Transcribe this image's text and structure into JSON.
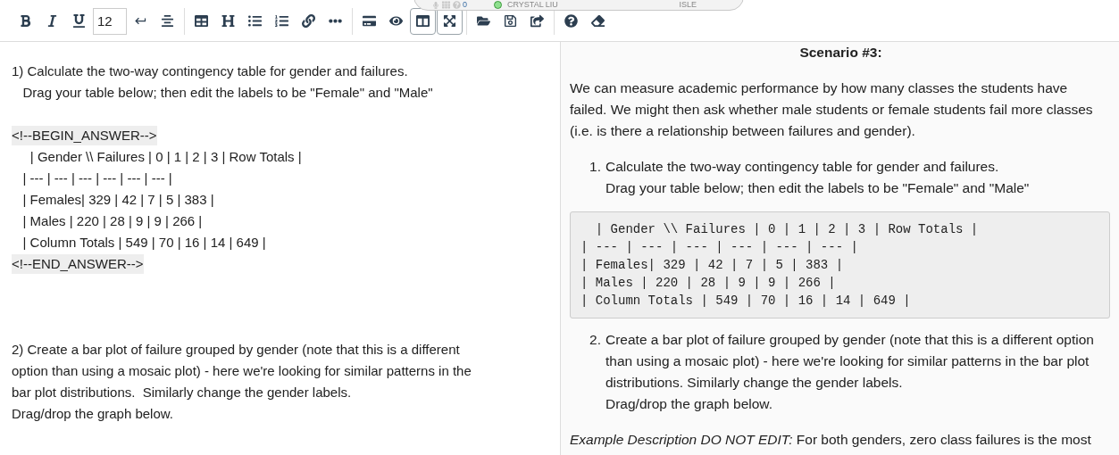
{
  "status_panel": {
    "count": "0",
    "online": true,
    "user": "CRYSTAL LIU",
    "app": "ISLE"
  },
  "toolbar": {
    "groups": [
      [
        {
          "kind": "bold",
          "selected": false
        },
        {
          "kind": "italic",
          "selected": false
        },
        {
          "kind": "underline",
          "selected": false
        },
        {
          "kind": "font_size",
          "value": "12"
        },
        {
          "kind": "line_break",
          "selected": false
        },
        {
          "kind": "horizontal_rule",
          "selected": false
        }
      ],
      [
        {
          "kind": "table",
          "selected": false
        },
        {
          "kind": "heading",
          "selected": false
        },
        {
          "kind": "bullet_list",
          "selected": false
        },
        {
          "kind": "numbered_list",
          "selected": false
        },
        {
          "kind": "link",
          "selected": false
        },
        {
          "kind": "more",
          "selected": false
        }
      ],
      [
        {
          "kind": "card",
          "selected": false
        },
        {
          "kind": "preview",
          "selected": false
        },
        {
          "kind": "split_view",
          "selected": true
        },
        {
          "kind": "fullscreen",
          "selected": true
        }
      ],
      [
        {
          "kind": "open",
          "selected": false
        },
        {
          "kind": "save",
          "selected": false
        },
        {
          "kind": "share",
          "selected": false
        }
      ],
      [
        {
          "kind": "help",
          "selected": false
        },
        {
          "kind": "clear",
          "selected": false
        }
      ]
    ]
  },
  "editor": {
    "lines": [
      {
        "kind": "text",
        "text": "1) Calculate the two-way contingency table for gender and failures."
      },
      {
        "kind": "text",
        "text": "   Drag your table below; then edit the labels to be \"Female\" and \"Male\""
      },
      {
        "kind": "blank"
      },
      {
        "kind": "marker",
        "text": "<!--BEGIN_ANSWER-->"
      },
      {
        "kind": "text",
        "text": "     | Gender \\\\ Failures | 0 | 1 | 2 | 3 | Row Totals |"
      },
      {
        "kind": "text",
        "text": "   | --- | --- | --- | --- | --- | --- |"
      },
      {
        "kind": "text",
        "text": "   | Females| 329 | 42 | 7 | 5 | 383 |"
      },
      {
        "kind": "text",
        "text": "   | Males | 220 | 28 | 9 | 9 | 266 |"
      },
      {
        "kind": "text",
        "text": "   | Column Totals | 549 | 70 | 16 | 14 | 649 |"
      },
      {
        "kind": "marker",
        "text": "<!--END_ANSWER-->"
      },
      {
        "kind": "blank"
      },
      {
        "kind": "blank"
      },
      {
        "kind": "blank"
      },
      {
        "kind": "text",
        "text": "2) Create a bar plot of failure grouped by gender (note that this is a different"
      },
      {
        "kind": "text",
        "text": "option than using a mosaic plot) - here we're looking for similar patterns in the"
      },
      {
        "kind": "text",
        "text": "bar plot distributions.  Similarly change the gender labels."
      },
      {
        "kind": "text",
        "text": "Drag/drop the graph below."
      },
      {
        "kind": "blank"
      }
    ]
  },
  "preview": {
    "title": "Scenario #3:",
    "intro": "We can measure academic performance by how many classes the students have failed. We might then ask whether male students or female students fail more classes (i.e. is there a relationship between failures and gender).",
    "items": [
      {
        "number": "1.",
        "lines": [
          "Calculate the two-way contingency table for gender and failures.",
          "Drag your table below; then edit the labels to be \"Female\" and \"Male\""
        ],
        "code": [
          "  | Gender \\\\ Failures | 0 | 1 | 2 | 3 | Row Totals |",
          "| --- | --- | --- | --- | --- | --- |",
          "| Females| 329 | 42 | 7 | 5 | 383 |",
          "| Males | 220 | 28 | 9 | 9 | 266 |",
          "| Column Totals | 549 | 70 | 16 | 14 | 649 |"
        ]
      },
      {
        "number": "2.",
        "lines": [
          "Create a bar plot of failure grouped by gender (note that this is a different option than using a mosaic plot) - here we're looking for similar patterns in the bar plot distributions. Similarly change the gender labels.",
          "Drag/drop the graph below."
        ]
      }
    ],
    "example": "*Example Description DO NOT EDIT:* For both genders, zero class failures is the most"
  }
}
